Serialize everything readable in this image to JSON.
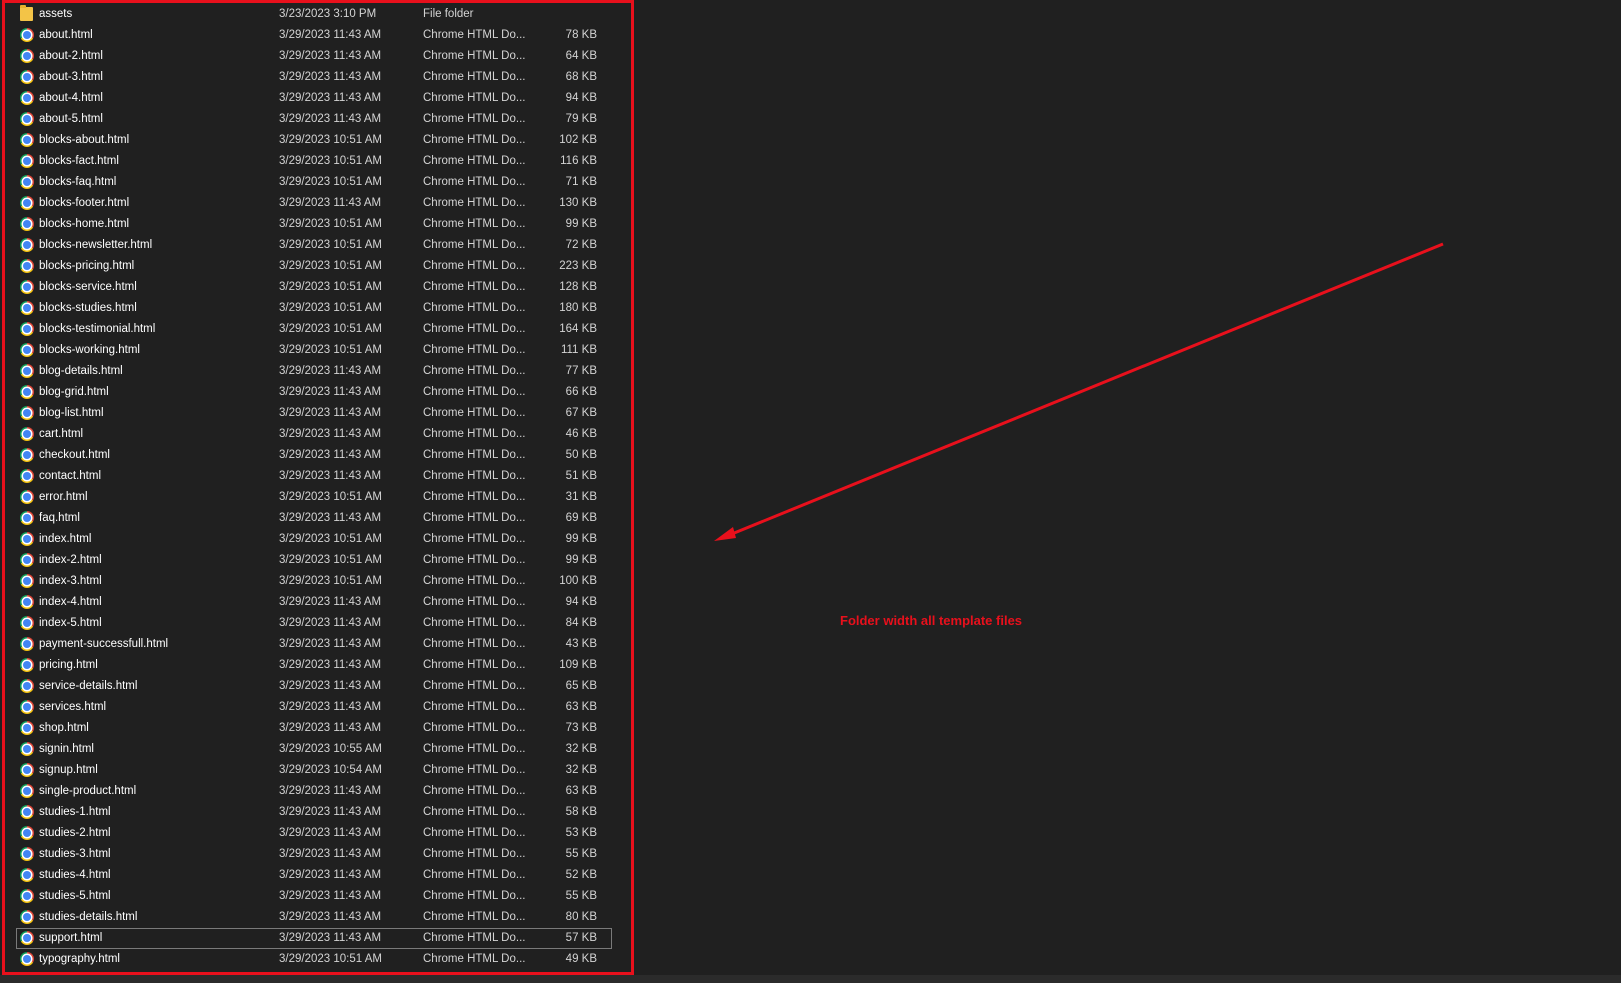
{
  "files": [
    {
      "name": "assets",
      "date": "3/23/2023 3:10 PM",
      "type": "File folder",
      "size": "",
      "icon": "folder-icon"
    },
    {
      "name": "about.html",
      "date": "3/29/2023 11:43 AM",
      "type": "Chrome HTML Do...",
      "size": "78 KB",
      "icon": "chrome-icon"
    },
    {
      "name": "about-2.html",
      "date": "3/29/2023 11:43 AM",
      "type": "Chrome HTML Do...",
      "size": "64 KB",
      "icon": "chrome-icon"
    },
    {
      "name": "about-3.html",
      "date": "3/29/2023 11:43 AM",
      "type": "Chrome HTML Do...",
      "size": "68 KB",
      "icon": "chrome-icon"
    },
    {
      "name": "about-4.html",
      "date": "3/29/2023 11:43 AM",
      "type": "Chrome HTML Do...",
      "size": "94 KB",
      "icon": "chrome-icon"
    },
    {
      "name": "about-5.html",
      "date": "3/29/2023 11:43 AM",
      "type": "Chrome HTML Do...",
      "size": "79 KB",
      "icon": "chrome-icon"
    },
    {
      "name": "blocks-about.html",
      "date": "3/29/2023 10:51 AM",
      "type": "Chrome HTML Do...",
      "size": "102 KB",
      "icon": "chrome-icon"
    },
    {
      "name": "blocks-fact.html",
      "date": "3/29/2023 10:51 AM",
      "type": "Chrome HTML Do...",
      "size": "116 KB",
      "icon": "chrome-icon"
    },
    {
      "name": "blocks-faq.html",
      "date": "3/29/2023 10:51 AM",
      "type": "Chrome HTML Do...",
      "size": "71 KB",
      "icon": "chrome-icon"
    },
    {
      "name": "blocks-footer.html",
      "date": "3/29/2023 11:43 AM",
      "type": "Chrome HTML Do...",
      "size": "130 KB",
      "icon": "chrome-icon"
    },
    {
      "name": "blocks-home.html",
      "date": "3/29/2023 10:51 AM",
      "type": "Chrome HTML Do...",
      "size": "99 KB",
      "icon": "chrome-icon"
    },
    {
      "name": "blocks-newsletter.html",
      "date": "3/29/2023 10:51 AM",
      "type": "Chrome HTML Do...",
      "size": "72 KB",
      "icon": "chrome-icon"
    },
    {
      "name": "blocks-pricing.html",
      "date": "3/29/2023 10:51 AM",
      "type": "Chrome HTML Do...",
      "size": "223 KB",
      "icon": "chrome-icon"
    },
    {
      "name": "blocks-service.html",
      "date": "3/29/2023 10:51 AM",
      "type": "Chrome HTML Do...",
      "size": "128 KB",
      "icon": "chrome-icon"
    },
    {
      "name": "blocks-studies.html",
      "date": "3/29/2023 10:51 AM",
      "type": "Chrome HTML Do...",
      "size": "180 KB",
      "icon": "chrome-icon"
    },
    {
      "name": "blocks-testimonial.html",
      "date": "3/29/2023 10:51 AM",
      "type": "Chrome HTML Do...",
      "size": "164 KB",
      "icon": "chrome-icon"
    },
    {
      "name": "blocks-working.html",
      "date": "3/29/2023 10:51 AM",
      "type": "Chrome HTML Do...",
      "size": "111 KB",
      "icon": "chrome-icon"
    },
    {
      "name": "blog-details.html",
      "date": "3/29/2023 11:43 AM",
      "type": "Chrome HTML Do...",
      "size": "77 KB",
      "icon": "chrome-icon"
    },
    {
      "name": "blog-grid.html",
      "date": "3/29/2023 11:43 AM",
      "type": "Chrome HTML Do...",
      "size": "66 KB",
      "icon": "chrome-icon"
    },
    {
      "name": "blog-list.html",
      "date": "3/29/2023 11:43 AM",
      "type": "Chrome HTML Do...",
      "size": "67 KB",
      "icon": "chrome-icon"
    },
    {
      "name": "cart.html",
      "date": "3/29/2023 11:43 AM",
      "type": "Chrome HTML Do...",
      "size": "46 KB",
      "icon": "chrome-icon"
    },
    {
      "name": "checkout.html",
      "date": "3/29/2023 11:43 AM",
      "type": "Chrome HTML Do...",
      "size": "50 KB",
      "icon": "chrome-icon"
    },
    {
      "name": "contact.html",
      "date": "3/29/2023 11:43 AM",
      "type": "Chrome HTML Do...",
      "size": "51 KB",
      "icon": "chrome-icon"
    },
    {
      "name": "error.html",
      "date": "3/29/2023 10:51 AM",
      "type": "Chrome HTML Do...",
      "size": "31 KB",
      "icon": "chrome-icon"
    },
    {
      "name": "faq.html",
      "date": "3/29/2023 11:43 AM",
      "type": "Chrome HTML Do...",
      "size": "69 KB",
      "icon": "chrome-icon"
    },
    {
      "name": "index.html",
      "date": "3/29/2023 10:51 AM",
      "type": "Chrome HTML Do...",
      "size": "99 KB",
      "icon": "chrome-icon"
    },
    {
      "name": "index-2.html",
      "date": "3/29/2023 10:51 AM",
      "type": "Chrome HTML Do...",
      "size": "99 KB",
      "icon": "chrome-icon"
    },
    {
      "name": "index-3.html",
      "date": "3/29/2023 10:51 AM",
      "type": "Chrome HTML Do...",
      "size": "100 KB",
      "icon": "chrome-icon"
    },
    {
      "name": "index-4.html",
      "date": "3/29/2023 11:43 AM",
      "type": "Chrome HTML Do...",
      "size": "94 KB",
      "icon": "chrome-icon"
    },
    {
      "name": "index-5.html",
      "date": "3/29/2023 11:43 AM",
      "type": "Chrome HTML Do...",
      "size": "84 KB",
      "icon": "chrome-icon"
    },
    {
      "name": "payment-successfull.html",
      "date": "3/29/2023 11:43 AM",
      "type": "Chrome HTML Do...",
      "size": "43 KB",
      "icon": "chrome-icon"
    },
    {
      "name": "pricing.html",
      "date": "3/29/2023 11:43 AM",
      "type": "Chrome HTML Do...",
      "size": "109 KB",
      "icon": "chrome-icon"
    },
    {
      "name": "service-details.html",
      "date": "3/29/2023 11:43 AM",
      "type": "Chrome HTML Do...",
      "size": "65 KB",
      "icon": "chrome-icon"
    },
    {
      "name": "services.html",
      "date": "3/29/2023 11:43 AM",
      "type": "Chrome HTML Do...",
      "size": "63 KB",
      "icon": "chrome-icon"
    },
    {
      "name": "shop.html",
      "date": "3/29/2023 11:43 AM",
      "type": "Chrome HTML Do...",
      "size": "73 KB",
      "icon": "chrome-icon"
    },
    {
      "name": "signin.html",
      "date": "3/29/2023 10:55 AM",
      "type": "Chrome HTML Do...",
      "size": "32 KB",
      "icon": "chrome-icon"
    },
    {
      "name": "signup.html",
      "date": "3/29/2023 10:54 AM",
      "type": "Chrome HTML Do...",
      "size": "32 KB",
      "icon": "chrome-icon"
    },
    {
      "name": "single-product.html",
      "date": "3/29/2023 11:43 AM",
      "type": "Chrome HTML Do...",
      "size": "63 KB",
      "icon": "chrome-icon"
    },
    {
      "name": "studies-1.html",
      "date": "3/29/2023 11:43 AM",
      "type": "Chrome HTML Do...",
      "size": "58 KB",
      "icon": "chrome-icon"
    },
    {
      "name": "studies-2.html",
      "date": "3/29/2023 11:43 AM",
      "type": "Chrome HTML Do...",
      "size": "53 KB",
      "icon": "chrome-icon"
    },
    {
      "name": "studies-3.html",
      "date": "3/29/2023 11:43 AM",
      "type": "Chrome HTML Do...",
      "size": "55 KB",
      "icon": "chrome-icon"
    },
    {
      "name": "studies-4.html",
      "date": "3/29/2023 11:43 AM",
      "type": "Chrome HTML Do...",
      "size": "52 KB",
      "icon": "chrome-icon"
    },
    {
      "name": "studies-5.html",
      "date": "3/29/2023 11:43 AM",
      "type": "Chrome HTML Do...",
      "size": "55 KB",
      "icon": "chrome-icon"
    },
    {
      "name": "studies-details.html",
      "date": "3/29/2023 11:43 AM",
      "type": "Chrome HTML Do...",
      "size": "80 KB",
      "icon": "chrome-icon"
    },
    {
      "name": "support.html",
      "date": "3/29/2023 11:43 AM",
      "type": "Chrome HTML Do...",
      "size": "57 KB",
      "icon": "chrome-icon",
      "selected": true
    },
    {
      "name": "typography.html",
      "date": "3/29/2023 10:51 AM",
      "type": "Chrome HTML Do...",
      "size": "49 KB",
      "icon": "chrome-icon"
    }
  ],
  "annotation": {
    "label": "Folder width all template files",
    "color": "#e8101c"
  },
  "colors": {
    "background": "#202020",
    "highlight": "#e8101c",
    "text": "#ffffff",
    "muted_text": "#d4d4d4"
  }
}
